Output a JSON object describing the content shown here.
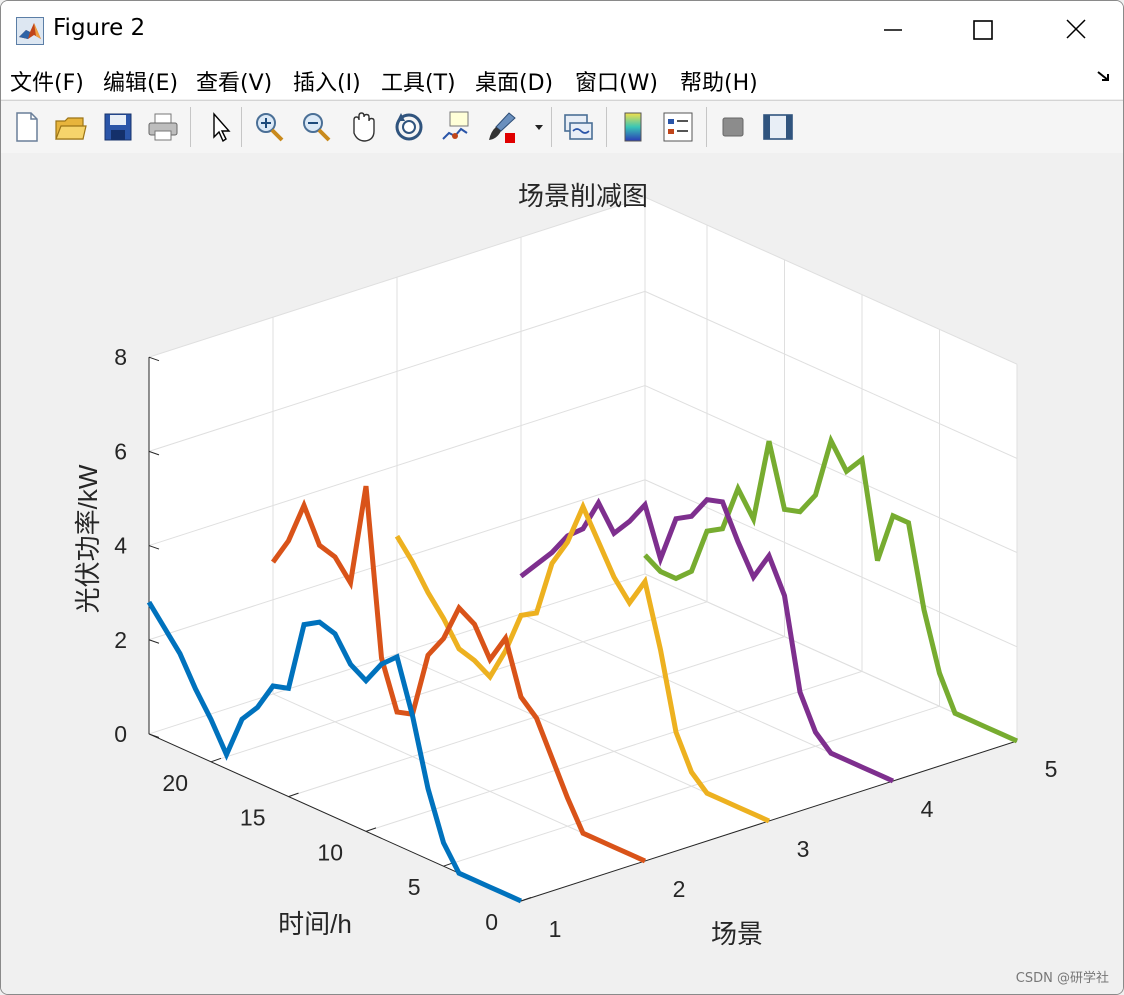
{
  "window": {
    "title": "Figure 2"
  },
  "menu": [
    "文件(F)",
    "编辑(E)",
    "查看(V)",
    "插入(I)",
    "工具(T)",
    "桌面(D)",
    "窗口(W)",
    "帮助(H)"
  ],
  "toolbar_icons": [
    "new-file-icon",
    "open-folder-icon",
    "save-icon",
    "print-icon",
    "pointer-icon",
    "zoom-in-icon",
    "zoom-out-icon",
    "pan-hand-icon",
    "rotate-3d-icon",
    "data-tips-icon",
    "brush-icon",
    "link-plot-icon",
    "colorbar-icon",
    "legend-icon",
    "hide-plot-tools-icon",
    "show-plot-tools-icon"
  ],
  "watermark": "CSDN @研学社",
  "chart_data": {
    "type": "line",
    "view": "3d",
    "title": "场景削减图",
    "xlabel": "场景",
    "ylabel": "时间/h",
    "zlabel": "光伏功率/kW",
    "xlim": [
      1,
      5
    ],
    "ylim": [
      0,
      24
    ],
    "zlim": [
      0,
      8
    ],
    "x_ticks": [
      "1",
      "2",
      "3",
      "4",
      "5"
    ],
    "y_ticks": [
      "0",
      "5",
      "10",
      "15",
      "20"
    ],
    "z_ticks": [
      "0",
      "2",
      "4",
      "6",
      "8"
    ],
    "grid": true,
    "hours": [
      0,
      1,
      2,
      3,
      4,
      5,
      6,
      7,
      8,
      9,
      10,
      11,
      12,
      13,
      14,
      15,
      16,
      17,
      18,
      19,
      20,
      21,
      22,
      23,
      24
    ],
    "series": [
      {
        "scenario": 1,
        "color": "#0072BD",
        "values": [
          0,
          0,
          0,
          0,
          0,
          0.5,
          1.5,
          2.9,
          4.0,
          3.7,
          3.2,
          3.4,
          3.9,
          4.0,
          3.8,
          2.3,
          2.2,
          1.6,
          1.2,
          0.3,
          0.9,
          1.4,
          2.0,
          2.4,
          2.8
        ]
      },
      {
        "scenario": 2,
        "color": "#D95319",
        "values": [
          0,
          0,
          0,
          0,
          0,
          0.6,
          1.3,
          2.0,
          2.3,
          3.4,
          2.8,
          3.4,
          3.6,
          2.8,
          2.3,
          0.9,
          0.8,
          1.8,
          5.3,
          3.1,
          3.5,
          3.6,
          4.3,
          3.4,
          2.8
        ]
      },
      {
        "scenario": 3,
        "color": "#EDB120",
        "values": [
          0,
          0,
          0,
          0,
          0,
          0.3,
          1.0,
          2.6,
          3.9,
          3.3,
          3.7,
          4.3,
          4.9,
          4.0,
          3.4,
          2.2,
          2.0,
          1.1,
          0.4,
          0.6,
          0.7,
          1.2,
          1.6,
          2.1,
          2.5
        ]
      },
      {
        "scenario": 4,
        "color": "#7E2F8E",
        "values": [
          0,
          0,
          0,
          0,
          0,
          0.3,
          1.0,
          2.9,
          3.6,
          3.0,
          3.6,
          4.3,
          4.2,
          3.7,
          3.5,
          2.5,
          3.5,
          3.0,
          2.6,
          3.1,
          2.4,
          2.1,
          1.6,
          1.2,
          0.8
        ]
      },
      {
        "scenario": 5,
        "color": "#77AC30",
        "values": [
          0,
          0,
          0,
          0,
          0,
          0.7,
          1.9,
          3.6,
          3.6,
          2.5,
          4.5,
          4.1,
          4.6,
          3.3,
          2.8,
          2.7,
          4.0,
          2.2,
          2.7,
          1.7,
          1.5,
          0.5,
          0.2,
          0.2,
          0.4
        ]
      }
    ]
  }
}
